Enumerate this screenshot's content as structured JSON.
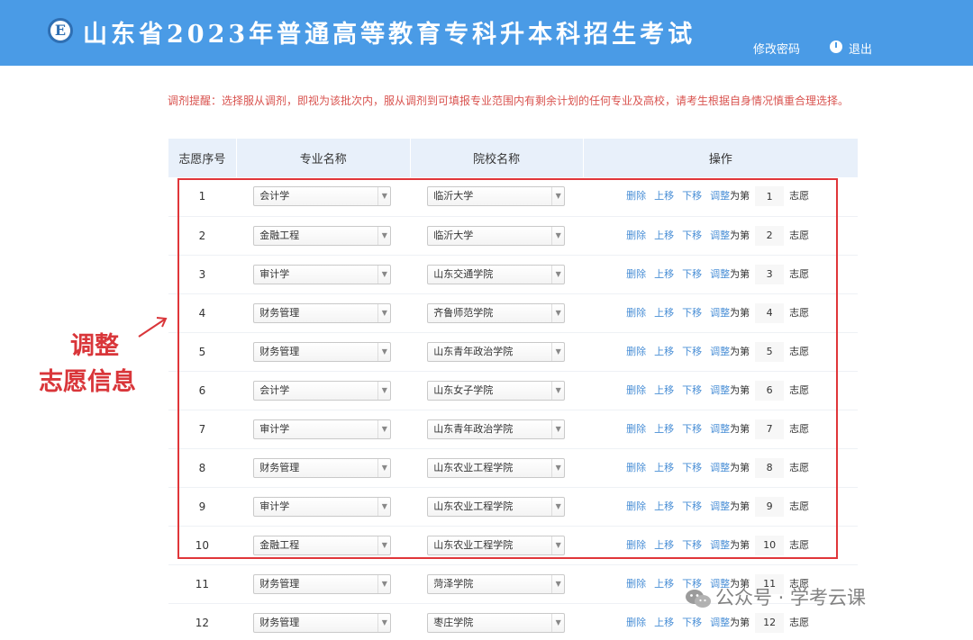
{
  "header": {
    "logo_glyph": "E",
    "title": "山东省2023年普通高等教育专科升本科招生考试",
    "change_password": "修改密码",
    "logout": "退出"
  },
  "notice": "调剂提醒：选择服从调剂，即视为该批次内，服从调剂到可填报专业范围内有剩余计划的任何专业及高校，请考生根据自身情况慎重合理选择。",
  "table": {
    "headers": [
      "志愿序号",
      "专业名称",
      "院校名称",
      "操作"
    ],
    "ops": {
      "delete": "删除",
      "up": "上移",
      "down": "下移",
      "adjust": "调整",
      "as": "为第",
      "wish": "志愿"
    },
    "rows": [
      {
        "seq": "1",
        "major": "会计学",
        "school": "临沂大学",
        "rank": "1"
      },
      {
        "seq": "2",
        "major": "金融工程",
        "school": "临沂大学",
        "rank": "2"
      },
      {
        "seq": "3",
        "major": "审计学",
        "school": "山东交通学院",
        "rank": "3"
      },
      {
        "seq": "4",
        "major": "财务管理",
        "school": "齐鲁师范学院",
        "rank": "4"
      },
      {
        "seq": "5",
        "major": "财务管理",
        "school": "山东青年政治学院",
        "rank": "5"
      },
      {
        "seq": "6",
        "major": "会计学",
        "school": "山东女子学院",
        "rank": "6"
      },
      {
        "seq": "7",
        "major": "审计学",
        "school": "山东青年政治学院",
        "rank": "7"
      },
      {
        "seq": "8",
        "major": "财务管理",
        "school": "山东农业工程学院",
        "rank": "8"
      },
      {
        "seq": "9",
        "major": "审计学",
        "school": "山东农业工程学院",
        "rank": "9"
      },
      {
        "seq": "10",
        "major": "金融工程",
        "school": "山东农业工程学院",
        "rank": "10"
      },
      {
        "seq": "11",
        "major": "财务管理",
        "school": "菏泽学院",
        "rank": "11"
      },
      {
        "seq": "12",
        "major": "财务管理",
        "school": "枣庄学院",
        "rank": "12"
      }
    ]
  },
  "annotation": {
    "line1": "调整",
    "line2": "志愿信息"
  },
  "watermark": "公众号 · 学考云课",
  "colors": {
    "header": "#4a9be6",
    "link": "#4a8fd6",
    "notice": "#d9534f",
    "highlight": "#e0363a"
  }
}
